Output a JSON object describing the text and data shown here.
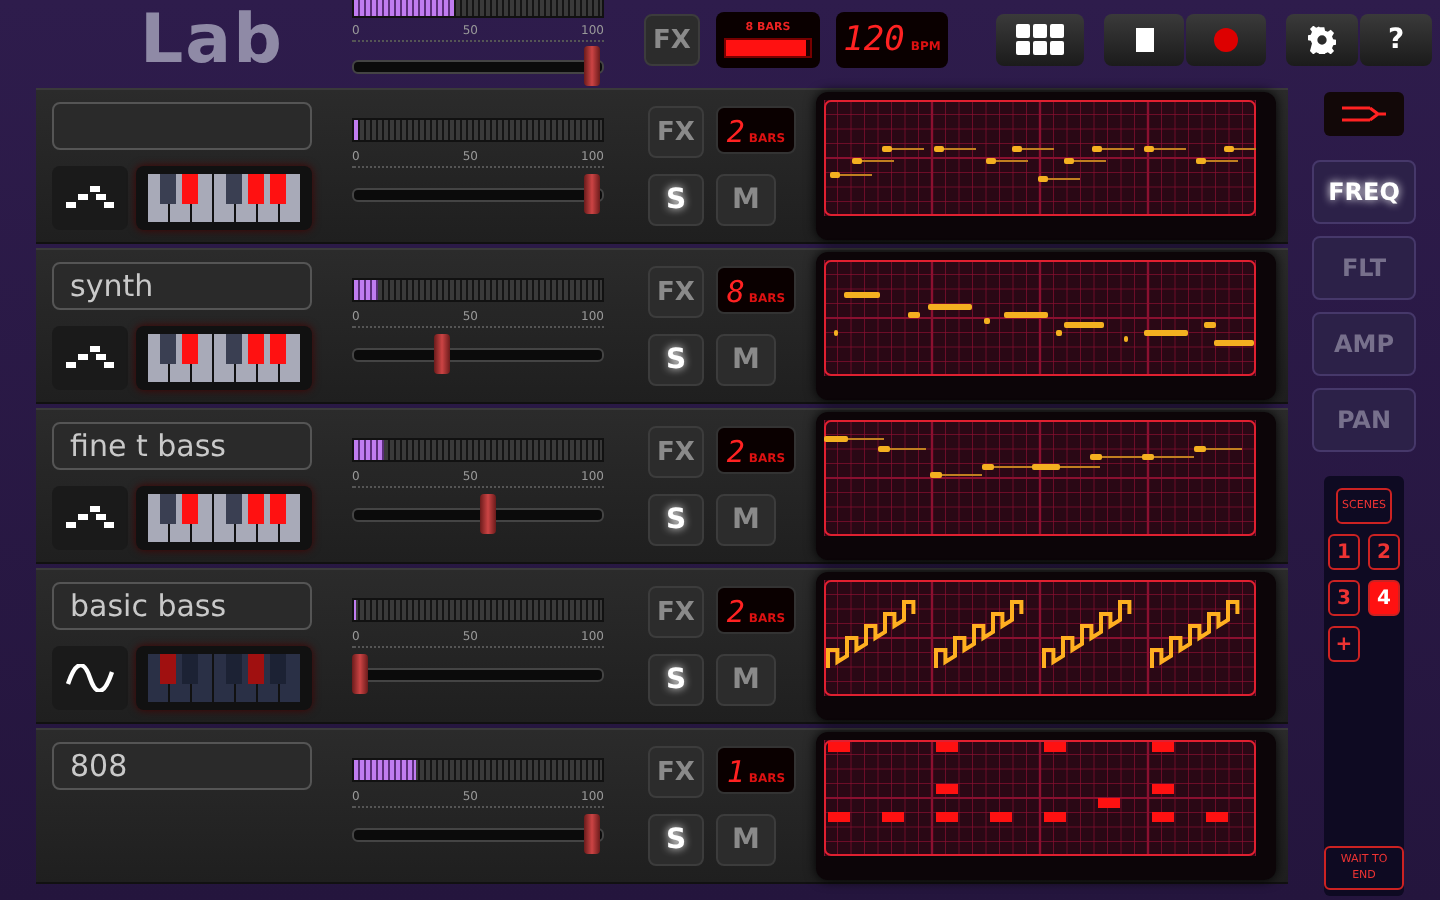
{
  "logo": "Lab",
  "master": {
    "meter": {
      "level": 0.4
    },
    "scale": [
      "0",
      "50",
      "100"
    ],
    "volume": {
      "level": 1
    },
    "fx": "FX",
    "loop": {
      "label": "8 BARS",
      "level": 0.95
    },
    "tempo": {
      "value": "120",
      "unit": "BPM"
    },
    "help": "?"
  },
  "tracks": [
    {
      "kind": "arp",
      "meter": {
        "level": 0.02
      },
      "scale": [
        "0",
        "50",
        "100"
      ],
      "volume": {
        "level": 1
      },
      "fx": "FX",
      "bars": "2",
      "bars_unit": "BARS",
      "solo": "S",
      "mute": "M"
    },
    {
      "kind": "arp",
      "name": "synth",
      "meter": {
        "level": 0.1
      },
      "scale": [
        "0",
        "50",
        "100"
      ],
      "volume": {
        "level": 0.35
      },
      "fx": "FX",
      "bars": "8",
      "bars_unit": "BARS",
      "solo": "S",
      "mute": "M"
    },
    {
      "kind": "arp",
      "name": "fine t bass",
      "meter": {
        "level": 0.12
      },
      "scale": [
        "0",
        "50",
        "100"
      ],
      "volume": {
        "level": 0.55
      },
      "fx": "FX",
      "bars": "2",
      "bars_unit": "BARS",
      "solo": "S",
      "mute": "M"
    },
    {
      "kind": "wave",
      "name": "basic bass",
      "meter": {
        "level": 0.01
      },
      "scale": [
        "0",
        "50",
        "100"
      ],
      "volume": {
        "level": 0
      },
      "fx": "FX",
      "bars": "2",
      "bars_unit": "BARS",
      "solo": "S",
      "mute": "M"
    },
    {
      "kind": "drum",
      "name": "808",
      "meter": {
        "level": 0.25
      },
      "scale": [
        "0",
        "50",
        "100"
      ],
      "volume": {
        "level": 1
      },
      "fx": "FX",
      "bars": "1",
      "bars_unit": "BARS",
      "solo": "S",
      "mute": "M"
    }
  ],
  "sidebar": {
    "params": [
      {
        "label": "FREQ",
        "selected": true
      },
      {
        "label": "FLT",
        "selected": false
      },
      {
        "label": "AMP",
        "selected": false
      },
      {
        "label": "PAN",
        "selected": false
      }
    ],
    "scenes": {
      "title": "SCENES",
      "items": [
        {
          "label": "1",
          "selected": false
        },
        {
          "label": "2",
          "selected": false
        },
        {
          "label": "3",
          "selected": false
        },
        {
          "label": "4",
          "selected": true
        }
      ],
      "add": "+",
      "wait": "WAIT TO END"
    }
  }
}
